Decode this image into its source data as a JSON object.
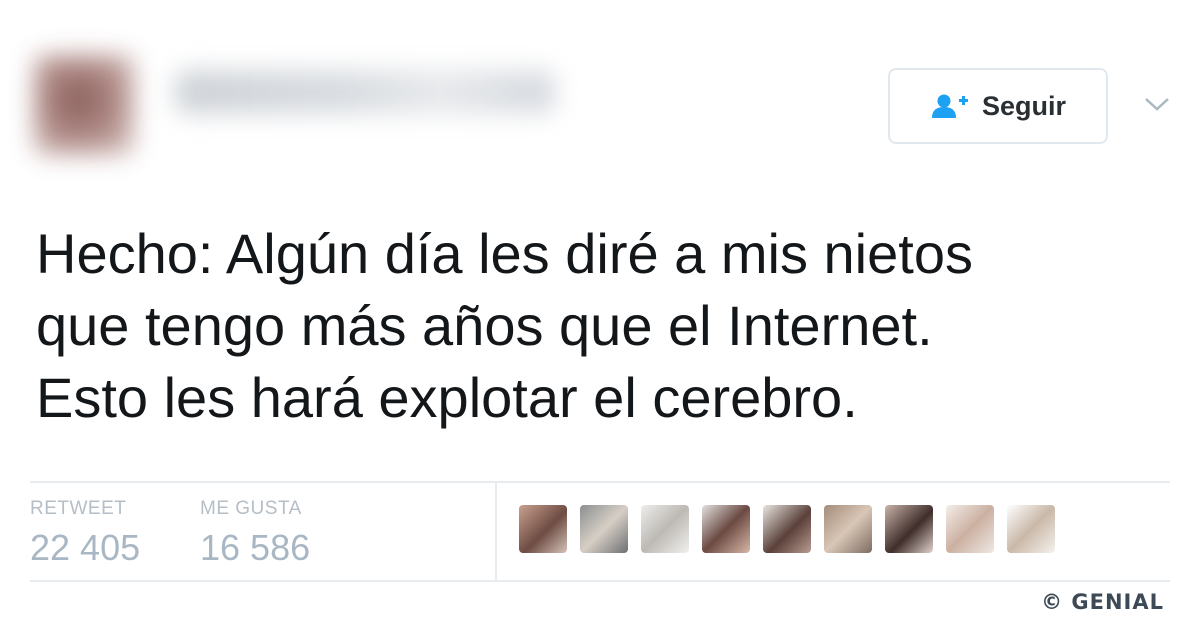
{
  "header": {
    "follow_label": "Seguir",
    "follow_icon": "add-user-icon",
    "menu_icon": "chevron-down-icon"
  },
  "tweet": {
    "lines": [
      "Hecho: Algún día les diré a mis nietos",
      "que tengo más años que el Internet.",
      "Esto les hará explotar el cerebro."
    ]
  },
  "stats": {
    "retweets": {
      "label": "RETWEET",
      "value": "22 405"
    },
    "likes": {
      "label": "ME GUSTA",
      "value": "16 586"
    }
  },
  "liker_avatar_count": 9,
  "watermark": "© GENIAL",
  "colors": {
    "accent": "#1da1f2",
    "text": "#14171a",
    "stat_value": "#a9b7c4",
    "stat_label": "#b5bec6"
  }
}
